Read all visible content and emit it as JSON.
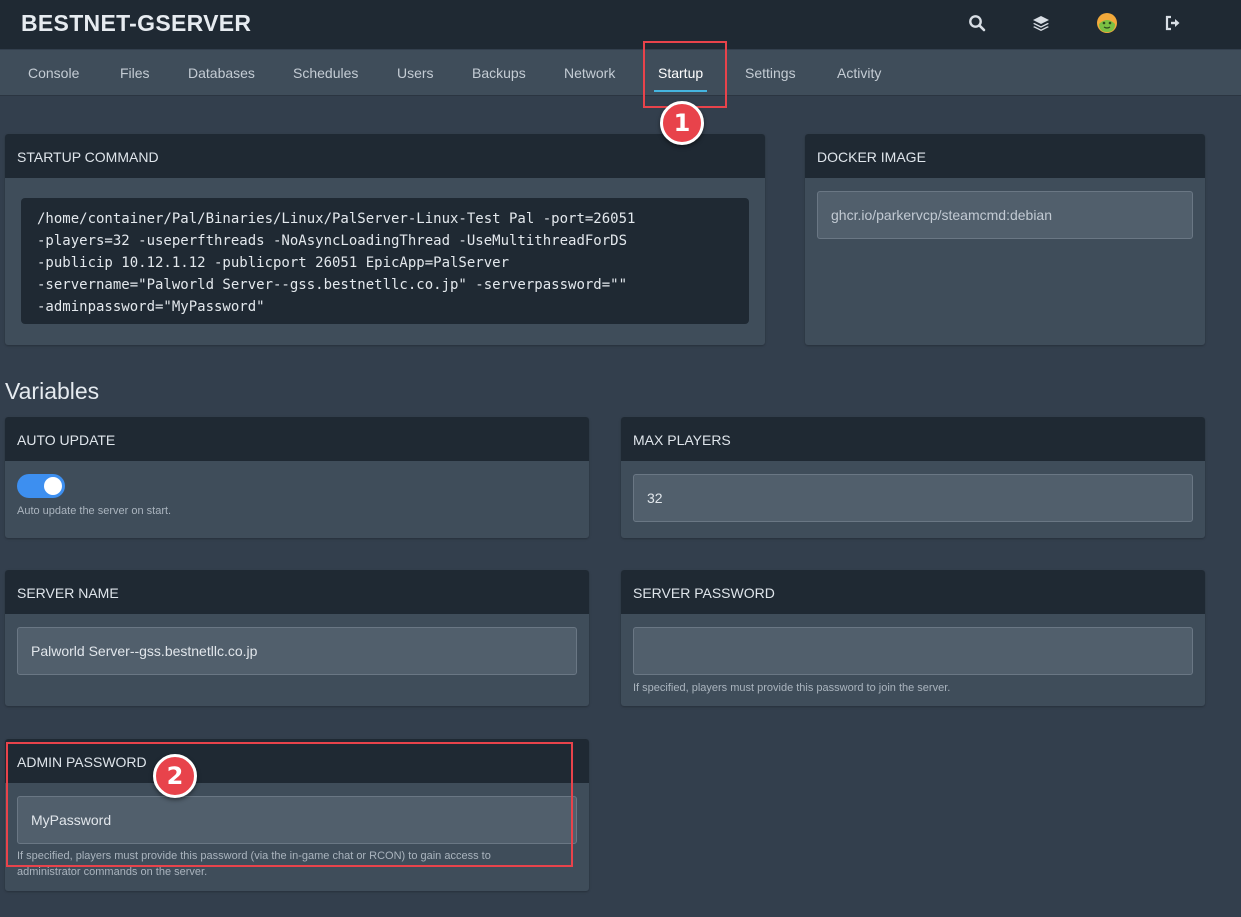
{
  "app": {
    "title": "BESTNET-GSERVER"
  },
  "top_icons": [
    "search-icon",
    "layers-icon",
    "avatar",
    "logout-icon"
  ],
  "nav": {
    "tabs": [
      {
        "label": "Console"
      },
      {
        "label": "Files"
      },
      {
        "label": "Databases"
      },
      {
        "label": "Schedules"
      },
      {
        "label": "Users"
      },
      {
        "label": "Backups"
      },
      {
        "label": "Network"
      },
      {
        "label": "Startup"
      },
      {
        "label": "Settings"
      },
      {
        "label": "Activity"
      }
    ],
    "active": "Startup"
  },
  "startup": {
    "title": "STARTUP COMMAND",
    "lines": [
      "/home/container/Pal/Binaries/Linux/PalServer-Linux-Test Pal -port=26051",
      "-players=32 -useperfthreads -NoAsyncLoadingThread -UseMultithreadForDS",
      "-publicip 10.12.1.12 -publicport 26051 EpicApp=PalServer",
      "-servername=\"Palworld Server--gss.bestnetllc.co.jp\" -serverpassword=\"\"",
      "-adminpassword=\"MyPassword\""
    ]
  },
  "docker": {
    "title": "DOCKER IMAGE",
    "value": "ghcr.io/parkervcp/steamcmd:debian"
  },
  "variables": {
    "heading": "Variables",
    "auto_update": {
      "title": "AUTO UPDATE",
      "enabled": true,
      "help": "Auto update the server on start."
    },
    "max_players": {
      "title": "MAX PLAYERS",
      "value": "32"
    },
    "server_name": {
      "title": "SERVER NAME",
      "value": "Palworld Server--gss.bestnetllc.co.jp"
    },
    "server_password": {
      "title": "SERVER PASSWORD",
      "value": "",
      "help": "If specified, players must provide this password to join the server."
    },
    "admin_password": {
      "title": "ADMIN PASSWORD",
      "value": "MyPassword",
      "help_line1": "If specified, players must provide this password (via the in-game chat or RCON) to gain access to",
      "help_line2": "administrator commands on the server."
    }
  },
  "annotations": {
    "marker1": "1",
    "marker2": "2",
    "color": "#e8434b"
  },
  "colors": {
    "accent": "#3d8ff0",
    "tab_underline": "#45b5e0",
    "header_bg": "#1f2933",
    "page_bg": "#333f4d"
  }
}
